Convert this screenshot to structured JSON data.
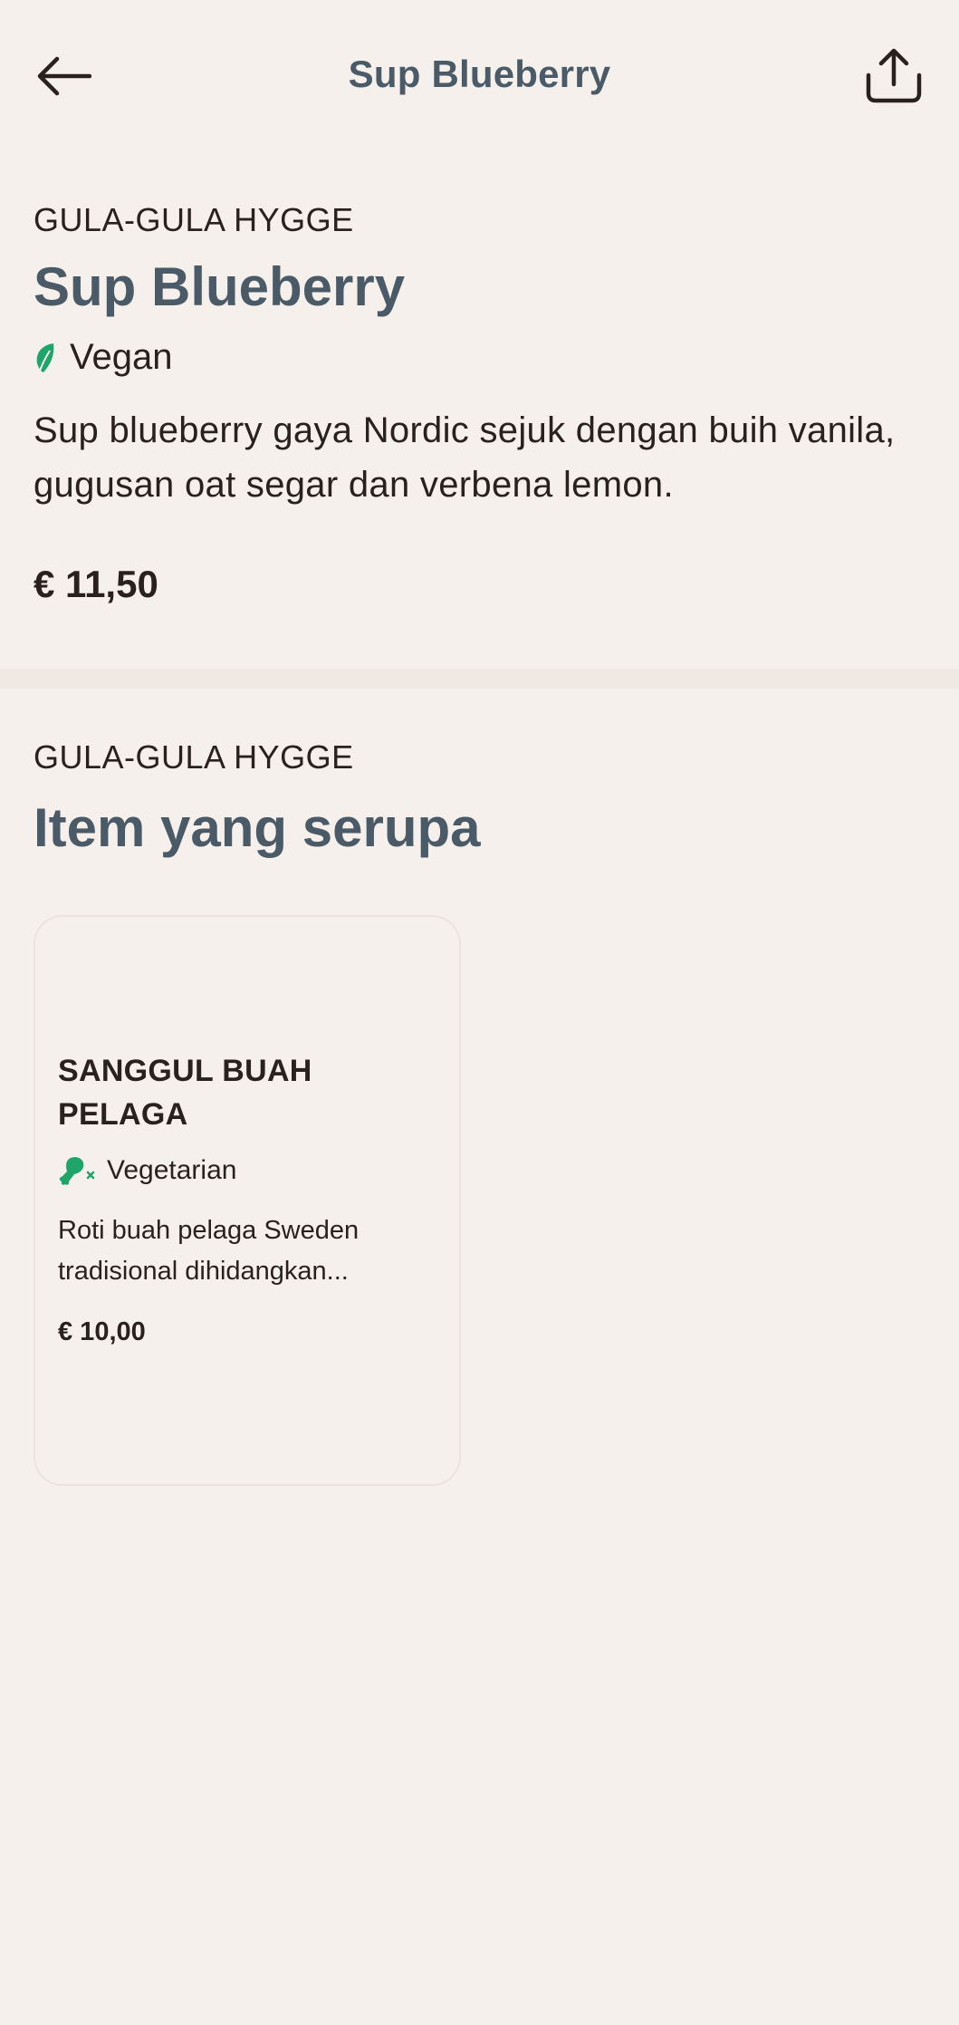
{
  "header": {
    "title": "Sup Blueberry",
    "back_icon": "arrow-left-icon",
    "share_icon": "share-icon"
  },
  "product": {
    "category": "GULA-GULA HYGGE",
    "name": "Sup Blueberry",
    "diet": "Vegan",
    "diet_icon": "leaf-icon",
    "description": "Sup blueberry gaya Nordic sejuk dengan buih vanila, gugusan oat segar dan verbena lemon.",
    "price": "€ 11,50"
  },
  "similar": {
    "category": "GULA-GULA HYGGE",
    "heading": "Item yang serupa",
    "items": [
      {
        "name": "SANGGUL BUAH PELAGA",
        "diet": "Vegetarian",
        "diet_icon": "no-meat-icon",
        "description": "Roti buah pelaga Sweden tradisional dihidangkan...",
        "price": "€ 10,00"
      }
    ]
  },
  "colors": {
    "background": "#f6f0ec",
    "heading": "#4a5a66",
    "text": "#2a211d",
    "accent_green": "#1fa56a"
  }
}
